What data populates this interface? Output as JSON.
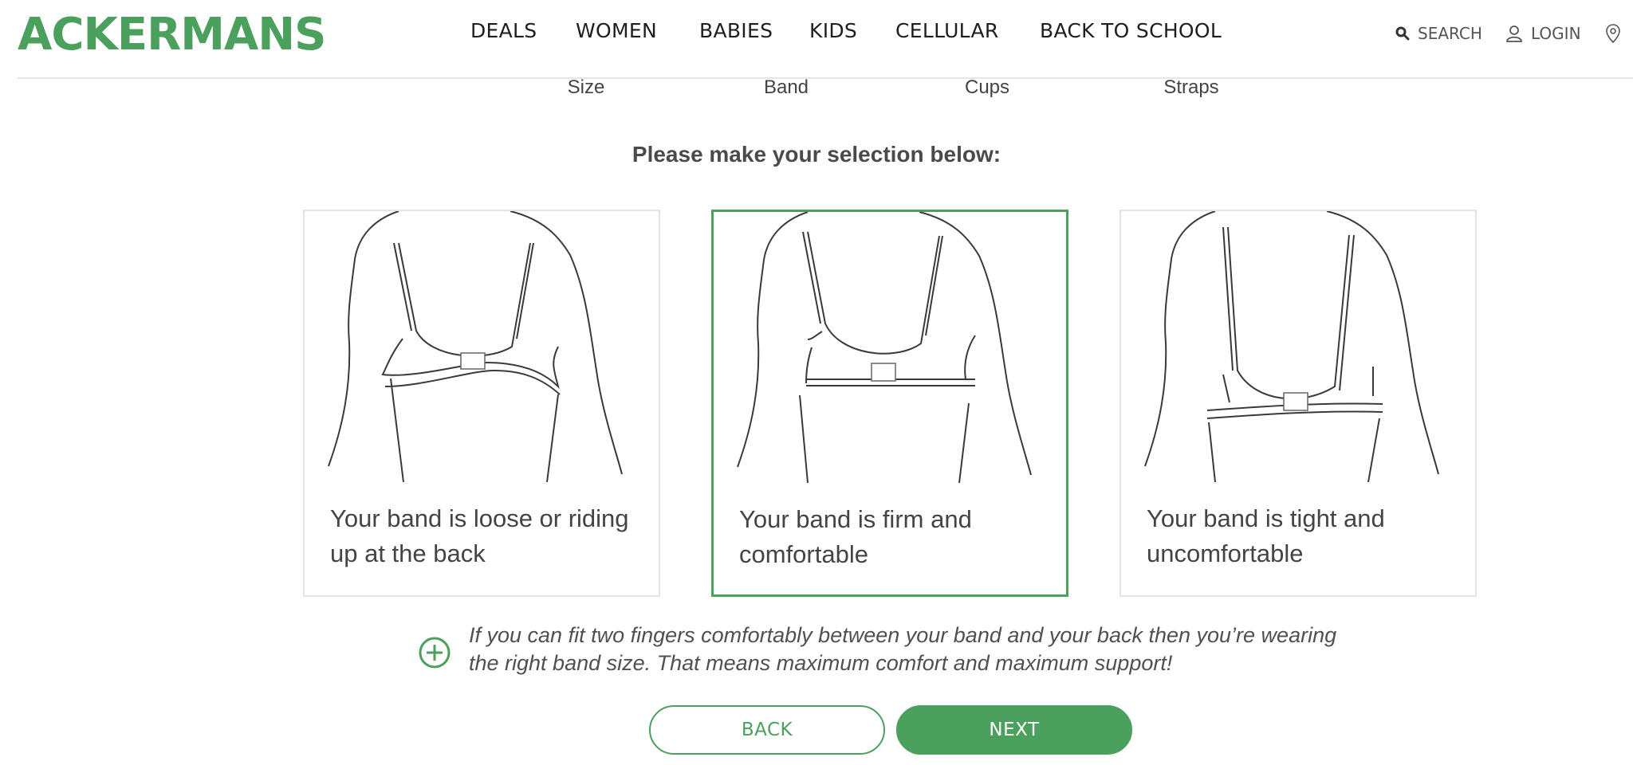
{
  "brand": {
    "name": "ACKERMANS",
    "color": "#4aa05c"
  },
  "nav": {
    "items": [
      {
        "label": "DEALS"
      },
      {
        "label": "WOMEN"
      },
      {
        "label": "BABIES"
      },
      {
        "label": "KIDS"
      },
      {
        "label": "CELLULAR"
      },
      {
        "label": "BACK TO SCHOOL"
      }
    ]
  },
  "utility": {
    "search_label": "SEARCH",
    "search_icon": "search-icon",
    "login_label": "LOGIN",
    "login_icon": "user-icon",
    "location_icon": "location-pin-icon"
  },
  "steps": [
    "Size",
    "Band",
    "Cups",
    "Straps"
  ],
  "main": {
    "heading": "Please make your selection below:",
    "options": [
      {
        "text": "Your band is loose or riding up at the back",
        "selected": false
      },
      {
        "text": "Your band is firm and comfortable",
        "selected": true
      },
      {
        "text": "Your band is tight and uncomfortable",
        "selected": false
      }
    ],
    "tip": {
      "icon": "plus-circle-icon",
      "text": "If you can fit two fingers comfortably between your band and your back then you’re wearing the right band size. That means maximum comfort and maximum support!"
    }
  },
  "actions": {
    "back_label": "BACK",
    "next_label": "NEXT"
  }
}
